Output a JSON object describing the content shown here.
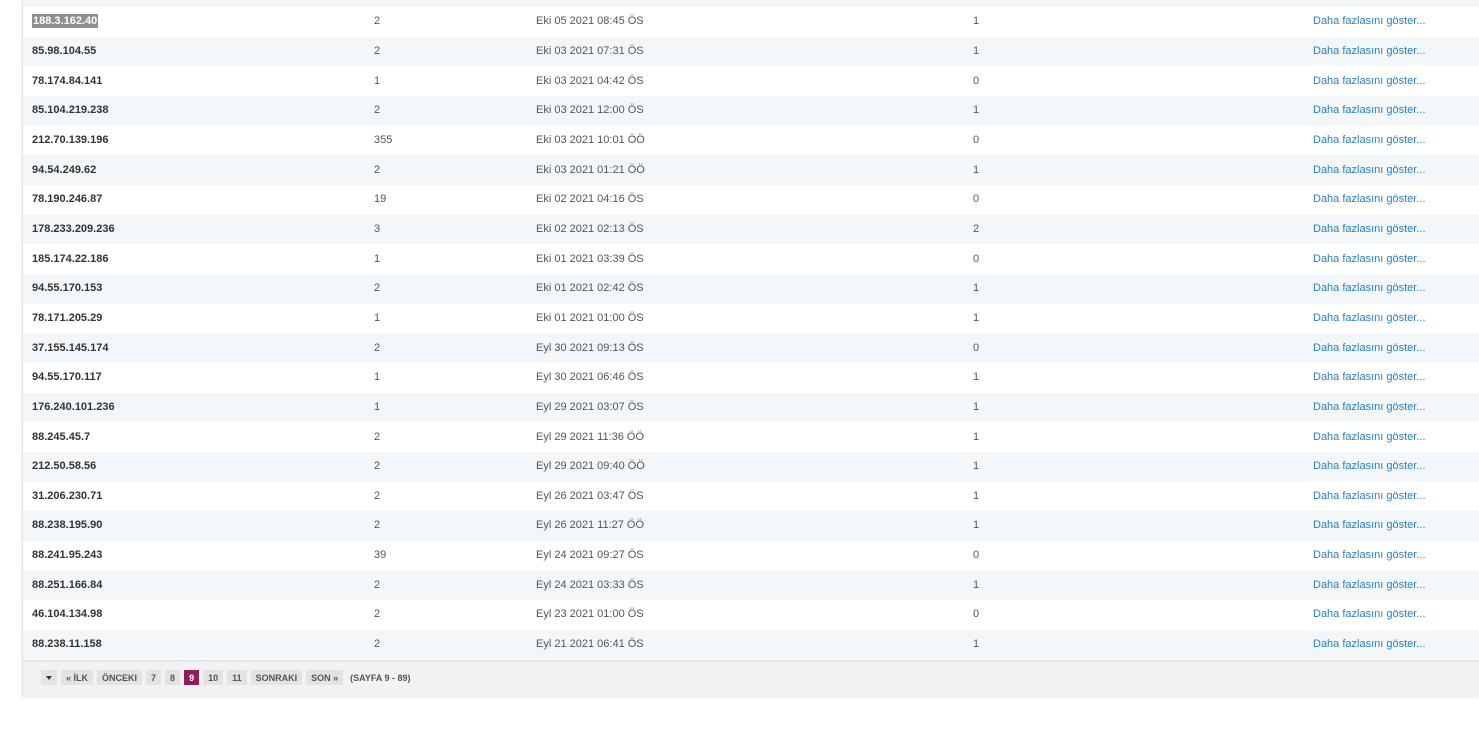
{
  "table": {
    "more_label": "Daha fazlasını göster...",
    "rows": [
      {
        "ip": "188.3.162.40",
        "count": "2",
        "date": "Eki 05 2021 08:45 ÖS",
        "num": "1"
      },
      {
        "ip": "85.98.104.55",
        "count": "2",
        "date": "Eki 03 2021 07:31 ÖS",
        "num": "1"
      },
      {
        "ip": "78.174.84.141",
        "count": "1",
        "date": "Eki 03 2021 04:42 ÖS",
        "num": "0"
      },
      {
        "ip": "85.104.219.238",
        "count": "2",
        "date": "Eki 03 2021 12:00 ÖS",
        "num": "1"
      },
      {
        "ip": "212.70.139.196",
        "count": "355",
        "date": "Eki 03 2021 10:01 ÖÖ",
        "num": "0"
      },
      {
        "ip": "94.54.249.62",
        "count": "2",
        "date": "Eki 03 2021 01:21 ÖÖ",
        "num": "1"
      },
      {
        "ip": "78.190.246.87",
        "count": "19",
        "date": "Eki 02 2021 04:16 ÖS",
        "num": "0"
      },
      {
        "ip": "178.233.209.236",
        "count": "3",
        "date": "Eki 02 2021 02:13 ÖS",
        "num": "2"
      },
      {
        "ip": "185.174.22.186",
        "count": "1",
        "date": "Eki 01 2021 03:39 ÖS",
        "num": "0"
      },
      {
        "ip": "94.55.170.153",
        "count": "2",
        "date": "Eki 01 2021 02:42 ÖS",
        "num": "1"
      },
      {
        "ip": "78.171.205.29",
        "count": "1",
        "date": "Eki 01 2021 01:00 ÖS",
        "num": "1"
      },
      {
        "ip": "37.155.145.174",
        "count": "2",
        "date": "Eyl 30 2021 09:13 ÖS",
        "num": "0"
      },
      {
        "ip": "94.55.170.117",
        "count": "1",
        "date": "Eyl 30 2021 06:46 ÖS",
        "num": "1"
      },
      {
        "ip": "176.240.101.236",
        "count": "1",
        "date": "Eyl 29 2021 03:07 ÖS",
        "num": "1"
      },
      {
        "ip": "88.245.45.7",
        "count": "2",
        "date": "Eyl 29 2021 11:36 ÖÖ",
        "num": "1"
      },
      {
        "ip": "212.50.58.56",
        "count": "2",
        "date": "Eyl 29 2021 09:40 ÖÖ",
        "num": "1"
      },
      {
        "ip": "31.206.230.71",
        "count": "2",
        "date": "Eyl 26 2021 03:47 ÖS",
        "num": "1"
      },
      {
        "ip": "88.238.195.90",
        "count": "2",
        "date": "Eyl 26 2021 11:27 ÖÖ",
        "num": "1"
      },
      {
        "ip": "88.241.95.243",
        "count": "39",
        "date": "Eyl 24 2021 09:27 ÖS",
        "num": "0"
      },
      {
        "ip": "88.251.166.84",
        "count": "2",
        "date": "Eyl 24 2021 03:33 ÖS",
        "num": "1"
      },
      {
        "ip": "46.104.134.98",
        "count": "2",
        "date": "Eyl 23 2021 01:00 ÖS",
        "num": "0"
      },
      {
        "ip": "88.238.11.158",
        "count": "2",
        "date": "Eyl 21 2021 06:41 ÖS",
        "num": "1"
      }
    ]
  },
  "pagination": {
    "first": "« İLK",
    "prev": "ÖNCEKI",
    "pages": [
      "7",
      "8",
      "9",
      "10",
      "11"
    ],
    "current": "9",
    "next": "SONRAKI",
    "last": "SON »",
    "info": "(SAYFA 9 - 89)"
  },
  "colors": {
    "active_page": "#8e1f5c",
    "link": "#2a7fc0",
    "row_stripe": "#f4f7fa"
  }
}
